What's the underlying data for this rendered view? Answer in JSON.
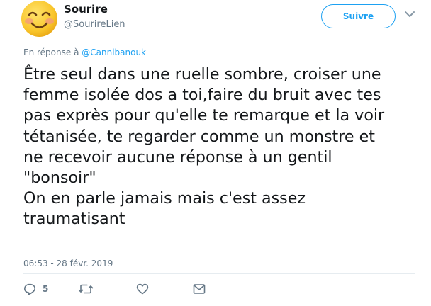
{
  "author": {
    "display_name": "Sourire",
    "username": "@SourireLien",
    "avatar_icon": "smiling-face-emoji-icon"
  },
  "follow_button": {
    "label": "Suivre"
  },
  "reply_context": {
    "prefix": "En réponse à",
    "mention": "@Cannibanouk"
  },
  "tweet": {
    "text": "Être seul dans une ruelle sombre, croiser une\nfemme isolée dos a toi,faire du bruit avec tes\npas exprès pour qu'elle te remarque et la voir\ntétanisée, te regarder comme un monstre et\nne recevoir aucune réponse à un gentil\n\"bonsoir\"\nOn en parle jamais mais c'est assez\ntraumatisant",
    "timestamp": "06:53 - 28 févr. 2019"
  },
  "actions": {
    "reply_count": "5",
    "icons": [
      "reply-icon",
      "retweet-icon",
      "like-icon",
      "direct-message-icon"
    ]
  },
  "colors": {
    "accent": "#1da1f2",
    "text": "#14171a",
    "muted": "#657786",
    "divider": "#e6ecf0"
  }
}
